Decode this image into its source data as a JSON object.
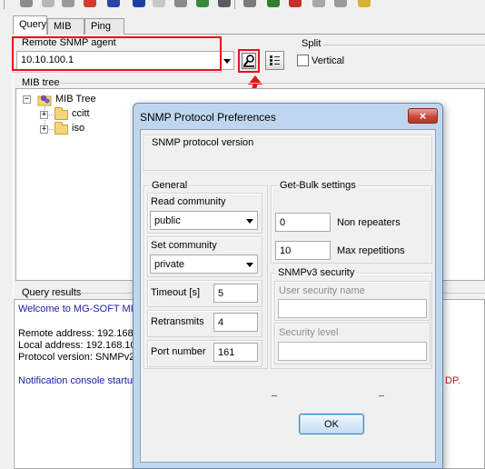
{
  "tabs": [
    {
      "label": "Query",
      "active": true
    },
    {
      "label": "MIB",
      "active": false
    },
    {
      "label": "Ping",
      "active": false
    }
  ],
  "agent": {
    "group_label": "Remote SNMP agent",
    "value": "10.10.100.1"
  },
  "split": {
    "group_label": "Split",
    "vertical_label": "Vertical",
    "vertical_checked": false
  },
  "mib_tree": {
    "group_label": "MIB tree",
    "root": "MIB Tree",
    "children": [
      "ccitt",
      "iso"
    ]
  },
  "query_results": {
    "group_label": "Query results",
    "lines": [
      {
        "text": "Welcome to MG-SOFT MIB",
        "style": "blue"
      },
      {
        "text": "Remote address: 192.168.1",
        "style": "normal"
      },
      {
        "text": "Local address: 192.168.10",
        "style": "normal"
      },
      {
        "text": "Protocol version: SNMPv2",
        "style": "normal"
      },
      {
        "text": "Notification console startup",
        "style": "blue"
      }
    ],
    "overflow_tail": "DP."
  },
  "dialog": {
    "title": "SNMP Protocol Preferences",
    "close_glyph": "×",
    "protocol_version_label": "SNMP protocol version",
    "general": {
      "label": "General",
      "read_community_label": "Read community",
      "read_community_value": "public",
      "set_community_label": "Set community",
      "set_community_value": "private",
      "timeout_label": "Timeout [s]",
      "timeout_value": "5",
      "retransmits_label": "Retransmits",
      "retransmits_value": "4",
      "port_label": "Port number",
      "port_value": "161"
    },
    "getbulk": {
      "label": "Get-Bulk settings",
      "non_repeaters_value": "0",
      "non_repeaters_label": "Non repeaters",
      "max_repetitions_value": "10",
      "max_repetitions_label": "Max repetitions"
    },
    "snmpv3": {
      "label": "SNMPv3 security",
      "user_label": "User security name",
      "user_value": "",
      "level_label": "Security level",
      "level_value": ""
    },
    "ok_label": "OK"
  },
  "colors": {
    "highlight_red": "#e8121b",
    "dialog_frame": "#bfd7ee",
    "close_button": "#c94a3c",
    "text_blue": "#1a1aa8"
  },
  "icons": [
    "query-agent-icon",
    "list-properties-icon",
    "red-arrow-pointer",
    "mib-tree-root-icon",
    "folder-icon",
    "close-icon"
  ]
}
